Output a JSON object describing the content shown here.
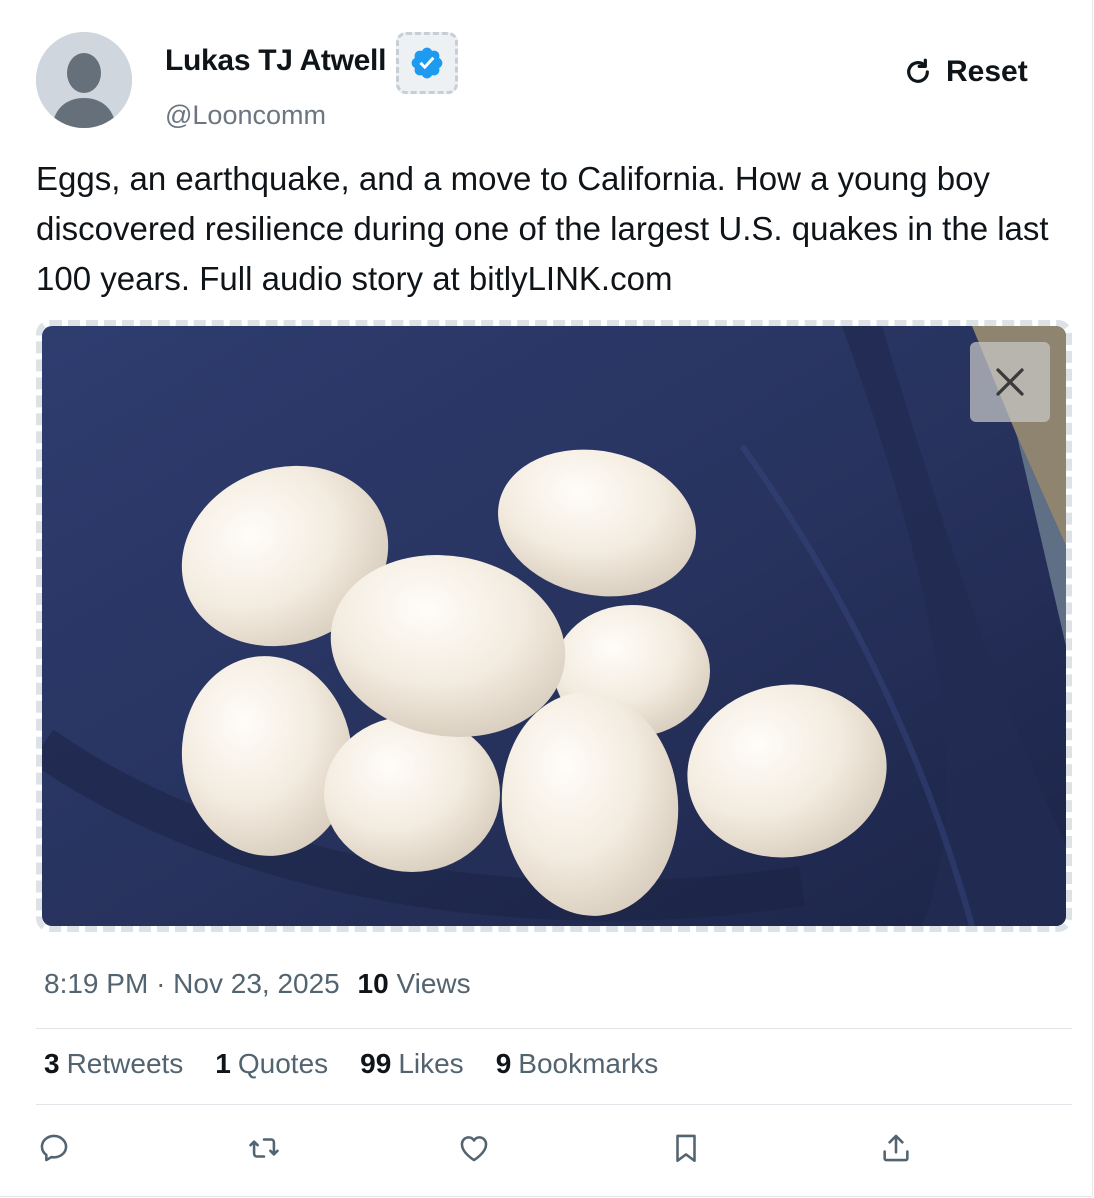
{
  "author": {
    "name": "Lukas TJ Atwell",
    "handle": "@Looncomm",
    "verified": true
  },
  "header": {
    "reset_label": "Reset",
    "reset_icon": "refresh-icon"
  },
  "tweet": {
    "text": "Eggs, an earthquake, and a move to California. How a young boy discovered resilience during one of the largest U.S. quakes in the last 100 years. Full audio story at bitlyLINK.com"
  },
  "media": {
    "close_icon": "close-icon"
  },
  "meta": {
    "time": "8:19 PM",
    "separator": "·",
    "date": "Nov 23, 2025",
    "views_count": "10",
    "views_label": "Views"
  },
  "stats": [
    {
      "count": "3",
      "label": "Retweets"
    },
    {
      "count": "1",
      "label": "Quotes"
    },
    {
      "count": "99",
      "label": "Likes"
    },
    {
      "count": "9",
      "label": "Bookmarks"
    }
  ],
  "actions": [
    "reply-icon",
    "retweet-icon",
    "like-icon",
    "bookmark-icon",
    "share-icon"
  ],
  "colors": {
    "text": "#0f1419",
    "secondary": "#536471",
    "verified": "#1d9bf0",
    "divider": "#e1e5e9"
  }
}
